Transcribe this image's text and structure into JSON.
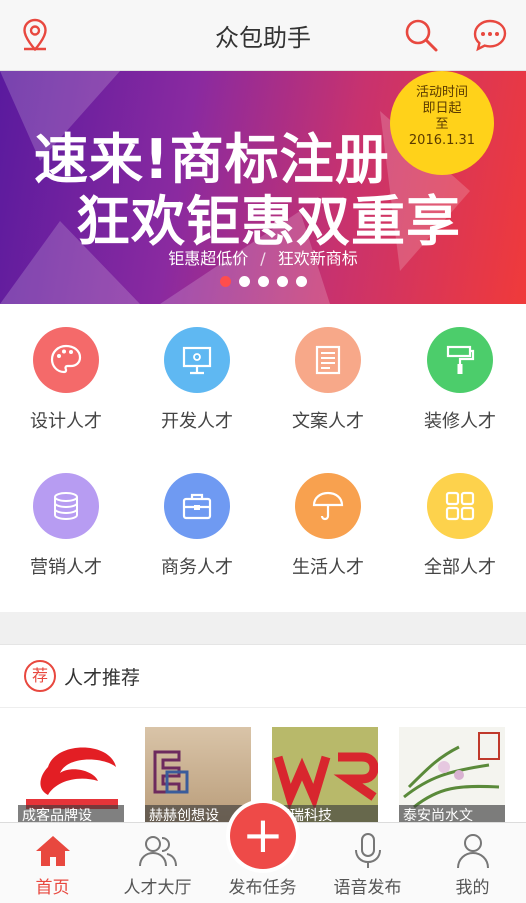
{
  "header": {
    "title": "众包助手"
  },
  "banner": {
    "badge_line1": "活动时间",
    "badge_line2": "即日起",
    "badge_line3": "至",
    "badge_line4": "2016.1.31",
    "headline1": "速来!商标注册",
    "headline2": "狂欢钜惠双重享",
    "sub_left": "钜惠超低价",
    "sub_sep": "/",
    "sub_right": "狂欢新商标",
    "slides_total": 5,
    "slide_active": 1
  },
  "categories": [
    {
      "label": "设计人才",
      "color": "#f46a6a"
    },
    {
      "label": "开发人才",
      "color": "#5fb8f2"
    },
    {
      "label": "文案人才",
      "color": "#f7a889"
    },
    {
      "label": "装修人才",
      "color": "#4ccd6b"
    },
    {
      "label": "营销人才",
      "color": "#b79cf2"
    },
    {
      "label": "商务人才",
      "color": "#6f9af2"
    },
    {
      "label": "生活人才",
      "color": "#f8a14f"
    },
    {
      "label": "全部人才",
      "color": "#fdd24c"
    }
  ],
  "recommend": {
    "badge": "荐",
    "title": "人才推荐",
    "items": [
      {
        "caption": "成客品牌设"
      },
      {
        "caption": "赫赫创想设"
      },
      {
        "caption": "万瑞科技"
      },
      {
        "caption": "泰安尚水文"
      }
    ]
  },
  "tabs": [
    {
      "label": "首页"
    },
    {
      "label": "人才大厅"
    },
    {
      "label": "发布任务"
    },
    {
      "label": "语音发布"
    },
    {
      "label": "我的"
    }
  ],
  "colors": {
    "accent": "#e8483f",
    "badge": "#ffd21a"
  }
}
